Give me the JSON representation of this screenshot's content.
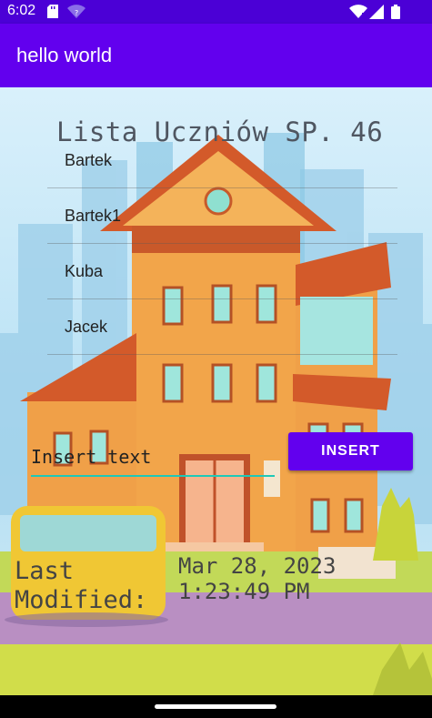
{
  "status_bar": {
    "time": "6:02",
    "icons": [
      "sd-card-icon",
      "wifi-icon",
      "wifi-signal-icon",
      "cell-signal-icon",
      "battery-icon"
    ]
  },
  "app_bar": {
    "title": "hello world"
  },
  "main": {
    "list_title": "Lista Uczniów SP. 46",
    "students": [
      "Bartek",
      "Bartek1",
      "Kuba",
      "Jacek"
    ],
    "input": {
      "placeholder": "Insert text"
    },
    "insert_button": "INSERT",
    "last_modified": {
      "label": "Last Modified:",
      "value": "Mar 28, 2023 1:23:49 PM"
    }
  },
  "colors": {
    "primary": "#6200ee",
    "status_bar": "#4b00d6",
    "accent": "#1ec8b8"
  }
}
